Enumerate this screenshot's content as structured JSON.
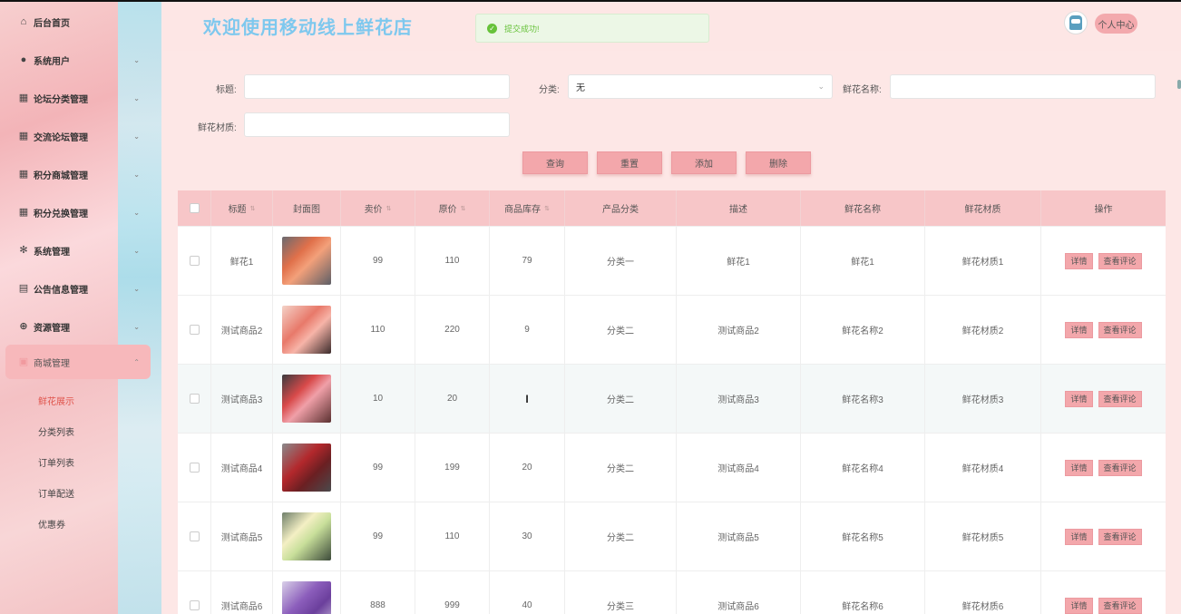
{
  "sidebar": {
    "menu": [
      {
        "label": "后台首页",
        "icon": "home-icon"
      },
      {
        "label": "系统用户",
        "icon": "user-icon"
      },
      {
        "label": "论坛分类管理",
        "icon": "grid-icon"
      },
      {
        "label": "交流论坛管理",
        "icon": "grid-icon"
      },
      {
        "label": "积分商城管理",
        "icon": "grid-icon"
      },
      {
        "label": "积分兑换管理",
        "icon": "grid-icon"
      },
      {
        "label": "系统管理",
        "icon": "gear-icon"
      },
      {
        "label": "公告信息管理",
        "icon": "document-icon"
      },
      {
        "label": "资源管理",
        "icon": "plus-circle-icon"
      },
      {
        "label": "商城管理",
        "icon": "shop-icon"
      }
    ],
    "submenu": [
      "鲜花展示",
      "分类列表",
      "订单列表",
      "订单配送",
      "优惠券"
    ]
  },
  "header": {
    "title": "欢迎使用移动线上鲜花店",
    "toast": "提交成功!",
    "user_center": "个人中心"
  },
  "filter": {
    "title_label": "标题:",
    "category_label": "分类:",
    "category_value": "无",
    "flower_name_label": "鲜花名称:",
    "material_label": "鲜花材质:",
    "buttons": {
      "query": "查询",
      "reset": "重置",
      "add": "添加",
      "delete": "删除"
    }
  },
  "table": {
    "headers": [
      "标题",
      "封面图",
      "卖价",
      "原价",
      "商品库存",
      "产品分类",
      "描述",
      "鲜花名称",
      "鲜花材质",
      "操作"
    ],
    "op_detail": "详情",
    "op_comments": "查看评论",
    "rows": [
      {
        "title": "鲜花1",
        "price": "99",
        "original": "110",
        "stock": "79",
        "category": "分类一",
        "desc": "鲜花1",
        "name": "鲜花1",
        "material": "鲜花材质1"
      },
      {
        "title": "测试商品2",
        "price": "110",
        "original": "220",
        "stock": "9",
        "category": "分类二",
        "desc": "测试商品2",
        "name": "鲜花名称2",
        "material": "鲜花材质2"
      },
      {
        "title": "测试商品3",
        "price": "10",
        "original": "20",
        "stock": "",
        "category": "分类二",
        "desc": "测试商品3",
        "name": "鲜花名称3",
        "material": "鲜花材质3"
      },
      {
        "title": "测试商品4",
        "price": "99",
        "original": "199",
        "stock": "20",
        "category": "分类二",
        "desc": "测试商品4",
        "name": "鲜花名称4",
        "material": "鲜花材质4"
      },
      {
        "title": "测试商品5",
        "price": "99",
        "original": "110",
        "stock": "30",
        "category": "分类二",
        "desc": "测试商品5",
        "name": "鲜花名称5",
        "material": "鲜花材质5"
      },
      {
        "title": "测试商品6",
        "price": "888",
        "original": "999",
        "stock": "40",
        "category": "分类三",
        "desc": "测试商品6",
        "name": "鲜花名称6",
        "material": "鲜花材质6"
      }
    ]
  },
  "colors": {
    "accent": "#f3a7ab",
    "title": "#7ec8ee",
    "active_sub": "#e0554d",
    "success": "#67c23a"
  }
}
